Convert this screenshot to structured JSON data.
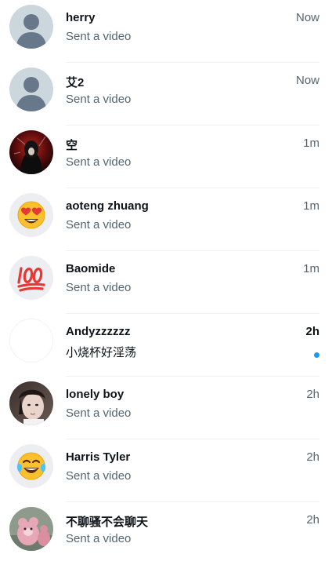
{
  "conversations": [
    {
      "name": "herry",
      "time": "Now",
      "preview": "Sent a video",
      "avatar_icon": "default-avatar-icon",
      "unread": false
    },
    {
      "name": "艾2",
      "time": "Now",
      "preview": "Sent a video",
      "avatar_icon": "default-avatar-icon",
      "unread": false
    },
    {
      "name": "空",
      "time": "1m",
      "preview": "Sent a video",
      "avatar_icon": "dark-photo-avatar",
      "unread": false
    },
    {
      "name": "aoteng zhuang",
      "time": "1m",
      "preview": "Sent a video",
      "avatar_icon": "heart-eyes-emoji-icon",
      "unread": false
    },
    {
      "name": "Baomide",
      "time": "1m",
      "preview": "Sent a video",
      "avatar_icon": "hundred-points-emoji-icon",
      "unread": false
    },
    {
      "name": "Andyzzzzzz",
      "time": "2h",
      "preview": "小烧杯好淫荡",
      "avatar_icon": "blank-avatar",
      "unread": true
    },
    {
      "name": "lonely boy",
      "time": "2h",
      "preview": "Sent a video",
      "avatar_icon": "portrait-photo-avatar",
      "unread": false
    },
    {
      "name": "Harris Tyler",
      "time": "2h",
      "preview": "Sent a video",
      "avatar_icon": "tears-of-joy-emoji-icon",
      "unread": false
    },
    {
      "name": "不聊骚不会聊天",
      "time": "2h",
      "preview": "Sent a video",
      "avatar_icon": "plush-toy-photo-avatar",
      "unread": false
    }
  ],
  "colors": {
    "primary_text": "#0f1419",
    "secondary_text": "#536471",
    "unread_dot": "#1d9bf0",
    "divider": "#eff3f4",
    "default_avatar_bg": "#ccd6dd",
    "default_avatar_fg": "#67788a"
  }
}
